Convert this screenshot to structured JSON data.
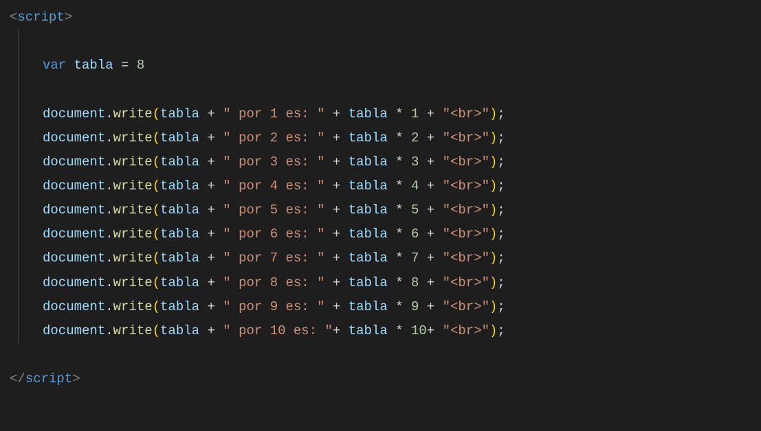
{
  "tags": {
    "open_lt": "<",
    "close_lt": "</",
    "gt": ">",
    "script": "script"
  },
  "decl": {
    "var_kw": "var",
    "sp1": " ",
    "name": "tabla",
    "sp2": " ",
    "eq": "=",
    "sp3": " ",
    "value": "8"
  },
  "common": {
    "obj": "document",
    "dot": ".",
    "method": "write",
    "lparen": "(",
    "arg_var": "tabla",
    "sp": " ",
    "plus": "+",
    "star": "*",
    "rparen": ")",
    "semi": ";",
    "br_str": "\"<br>\""
  },
  "lines": [
    {
      "por_str": "\" por 1 es: \"",
      "gap_after_por": " ",
      "mult_num": "1",
      "gap_after_num": " "
    },
    {
      "por_str": "\" por 2 es: \"",
      "gap_after_por": " ",
      "mult_num": "2",
      "gap_after_num": " "
    },
    {
      "por_str": "\" por 3 es: \"",
      "gap_after_por": " ",
      "mult_num": "3",
      "gap_after_num": " "
    },
    {
      "por_str": "\" por 4 es: \"",
      "gap_after_por": " ",
      "mult_num": "4",
      "gap_after_num": " "
    },
    {
      "por_str": "\" por 5 es: \"",
      "gap_after_por": " ",
      "mult_num": "5",
      "gap_after_num": " "
    },
    {
      "por_str": "\" por 6 es: \"",
      "gap_after_por": " ",
      "mult_num": "6",
      "gap_after_num": " "
    },
    {
      "por_str": "\" por 7 es: \"",
      "gap_after_por": " ",
      "mult_num": "7",
      "gap_after_num": " "
    },
    {
      "por_str": "\" por 8 es: \"",
      "gap_after_por": " ",
      "mult_num": "8",
      "gap_after_num": " "
    },
    {
      "por_str": "\" por 9 es: \"",
      "gap_after_por": " ",
      "mult_num": "9",
      "gap_after_num": " "
    },
    {
      "por_str": "\" por 10 es: \"",
      "gap_after_por": "",
      "mult_num": "10",
      "gap_after_num": ""
    }
  ]
}
